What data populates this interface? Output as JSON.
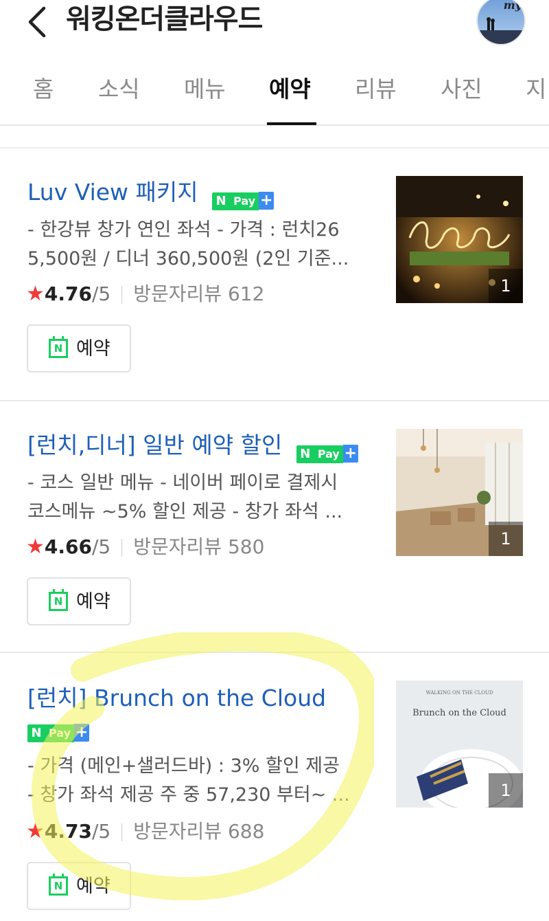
{
  "header": {
    "title": "워킹온더클라우드",
    "back_icon": "chevron-left-icon",
    "profile_mini_text": "my"
  },
  "tabs": [
    {
      "label": "홈",
      "active": false
    },
    {
      "label": "소식",
      "active": false
    },
    {
      "label": "메뉴",
      "active": false
    },
    {
      "label": "예약",
      "active": true
    },
    {
      "label": "리뷰",
      "active": false
    },
    {
      "label": "사진",
      "active": false
    },
    {
      "label": "지",
      "active": false
    }
  ],
  "npay": {
    "n": "N",
    "pay": "Pay",
    "plus": "+"
  },
  "reserve_button_label": "예약",
  "calendar_icon_letter": "N",
  "items": [
    {
      "title": "Luv View 패키지",
      "desc_line1": "- 한강뷰 창가 연인 좌석 - 가격 : 런치26",
      "desc_line2": "5,500원 / 디너 360,500원 (2인 기준...",
      "score": "4.76",
      "out_of": "/5",
      "reviews": "방문자리뷰 612",
      "photo_count": "1"
    },
    {
      "title": "[런치,디너] 일반 예약 할인",
      "desc_line1": "- 코스 일반 메뉴 - 네이버 페이로 결제시",
      "desc_line2": "코스메뉴 ~5% 할인 제공 - 창가 좌석 ...",
      "score": "4.66",
      "out_of": "/5",
      "reviews": "방문자리뷰 580",
      "photo_count": "1"
    },
    {
      "title_prefix": "[런치]",
      "title": "Brunch on the Cloud",
      "desc_line1": "- 가격 (메인+샐러드바) : 3% 할인 제공",
      "desc_line2": "- 창가 좌석 제공 주 중 57,230 부터~ ...",
      "score": "4.73",
      "out_of": "/5",
      "reviews": "방문자리뷰 688",
      "photo_count": "1",
      "thumb_text_small": "WALKING ON THE CLOUD",
      "thumb_text_title": "Brunch on the Cloud"
    }
  ],
  "colors": {
    "link_blue": "#1d5fb8",
    "naver_green": "#19ce60",
    "star_red": "#f03a3a",
    "highlight_yellow": "#f4f25a"
  }
}
